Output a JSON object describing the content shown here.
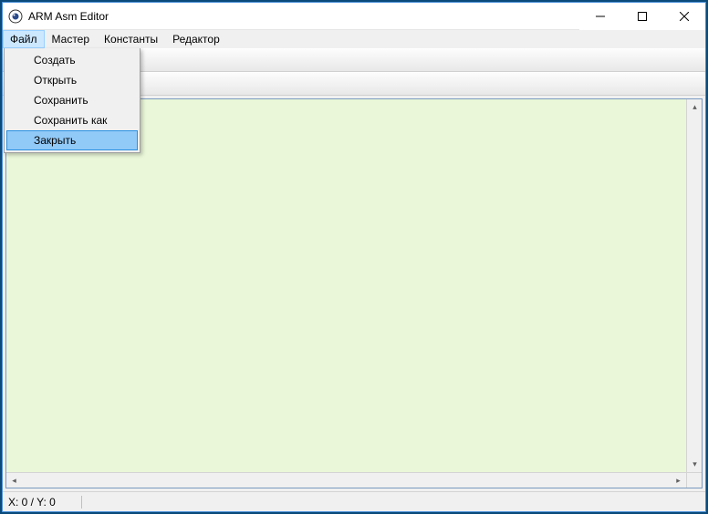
{
  "titlebar": {
    "title": "ARM Asm Editor"
  },
  "menubar": {
    "items": [
      {
        "label": "Файл"
      },
      {
        "label": "Мастер"
      },
      {
        "label": "Константы"
      },
      {
        "label": "Редактор"
      }
    ]
  },
  "file_menu": {
    "items": [
      {
        "label": "Создать"
      },
      {
        "label": "Открыть"
      },
      {
        "label": "Сохранить"
      },
      {
        "label": "Сохранить как"
      },
      {
        "label": "Закрыть"
      }
    ],
    "highlighted_index": 4
  },
  "statusbar": {
    "coords": "X: 0 / Y: 0"
  },
  "colors": {
    "editor_bg": "#eaf7d9",
    "menu_highlight": "#91c9f7",
    "accent": "#4a90d9"
  }
}
